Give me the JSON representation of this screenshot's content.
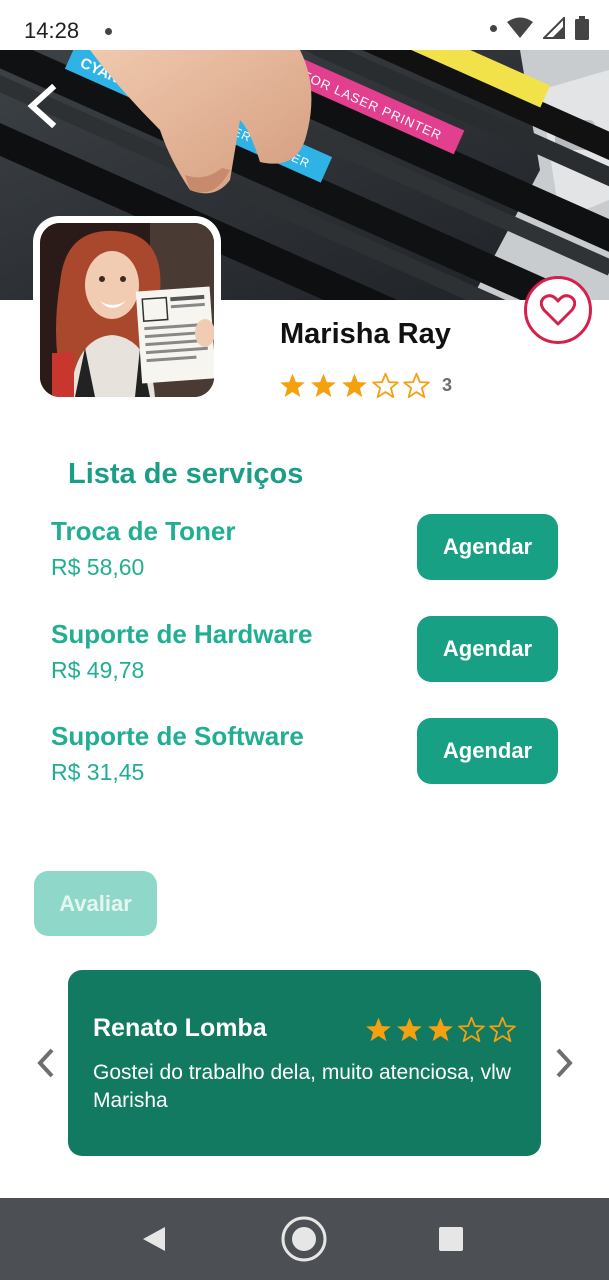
{
  "status_bar": {
    "time": "14:28",
    "icons": [
      "notification-dot-icon",
      "wifi-icon",
      "cellular-signal-icon",
      "battery-icon"
    ]
  },
  "hero": {
    "image": "laser printer toner cartridges photo",
    "back_icon": "chevron-left-icon"
  },
  "profile": {
    "name": "Marisha Ray",
    "rating": 3,
    "rating_max": 5,
    "rating_count": "3",
    "favorite_icon": "heart-icon"
  },
  "services": {
    "title": "Lista de serviços",
    "items": [
      {
        "name": "Troca de Toner",
        "price": "R$ 58,60",
        "button": "Agendar"
      },
      {
        "name": "Suporte de Hardware",
        "price": "R$ 49,78",
        "button": "Agendar"
      },
      {
        "name": "Suporte de Software",
        "price": "R$ 31,45",
        "button": "Agendar"
      }
    ]
  },
  "rate_button": "Avaliar",
  "review": {
    "author": "Renato Lomba",
    "rating": 3,
    "rating_max": 5,
    "text": "Gostei do trabalho dela, muito atenciosa, vlw Marisha"
  },
  "colors": {
    "accent": "#17a084",
    "service_text": "#22ae92",
    "review_card": "#137a62",
    "star": "#f5a00f",
    "favorite": "#d61f4d"
  }
}
